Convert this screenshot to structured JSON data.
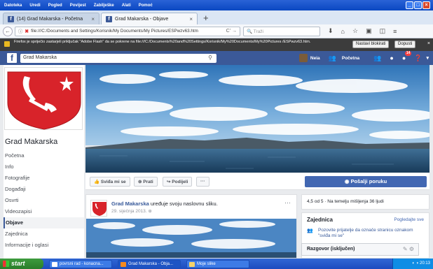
{
  "window": {
    "menu": [
      "Datoteka",
      "Uredi",
      "Pogled",
      "Povijest",
      "Zabilješke",
      "Alati",
      "Pomoć"
    ],
    "controls": [
      "_",
      "□",
      "×"
    ]
  },
  "tabs": [
    {
      "label": "(14) Grad Makarska - Početna",
      "fav": "f"
    },
    {
      "label": "Grad Makarska - Objave",
      "fav": "f"
    }
  ],
  "newtab_label": "+",
  "nav": {
    "url": "file:///C:/Documents and Settings/Korisnik/My Documents/My Pictures/ESPwzv63.htm",
    "search_placeholder": "Traži",
    "back": "←",
    "info": "ⓘ"
  },
  "plugin_bar": {
    "message": "Firefox je spriječio zastarjeli priključak \"Adobe Flash\" da se pokrene na file:///C:/Documents%20and%20Settings/Korisnik/My%20Documents/My%20Pictures /ESPwzv63.htm.",
    "continue_label": "Nastavi blokirati",
    "allow_label": "Dopusti"
  },
  "fb": {
    "search_value": "Grad Makarska",
    "user_name": "Neia",
    "home_label": "Početna",
    "notif_count": "14"
  },
  "left": {
    "page_name": "Grad Makarska",
    "nav_items": [
      "Početna",
      "Info",
      "Fotografije",
      "Događaji",
      "Osvrti",
      "Videozapisi",
      "Objave",
      "Zajednica",
      "Informacije i oglasi"
    ],
    "active_item": "Objave"
  },
  "actions": {
    "like": "Sviđa mi se",
    "follow": "Prati",
    "share": "Podijeli",
    "more": "···",
    "send_message": "Pošalji poruku"
  },
  "post": {
    "author": "Grad Makarska",
    "action": "uređuje svoju naslovnu sliku.",
    "date": "29. siječnja 2013.",
    "more": "···"
  },
  "right": {
    "rating": "4,5 od 5 · Na temelju mišljenja 36 ljudi",
    "community_title": "Zajednica",
    "see_all": "Pogledajte sve",
    "invite_text": "Pozovite prijatelje da označe stranicu oznakom \"sviđa mi se\"",
    "chat_label": "Razgovor (isključen)"
  },
  "taskbar": {
    "start": "start",
    "items": [
      "povrsni rad - konacna...",
      "Grad Makarska - Obja...",
      "Moje slike"
    ],
    "clock": "20:13"
  },
  "colors": {
    "fb_blue": "#3b5998",
    "button_blue": "#4267b2",
    "coat_of_arms_red": "#d8232a",
    "xp_taskbar": "#245edb"
  }
}
